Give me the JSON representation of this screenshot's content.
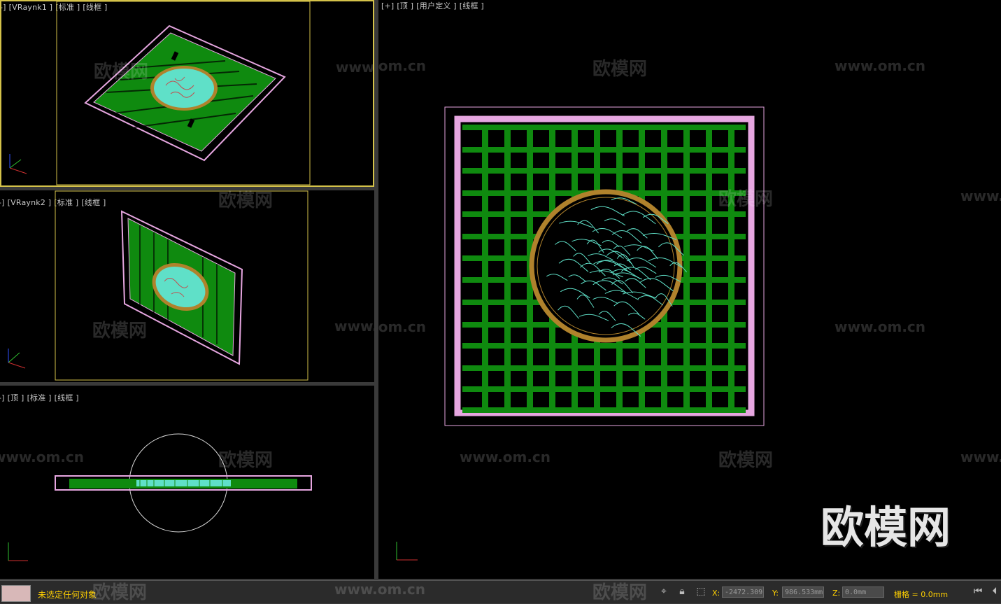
{
  "viewports": {
    "vp1": {
      "tags": [
        "-]",
        "[VRaynk1 ]",
        "[标准 ]",
        "[线框 ]"
      ]
    },
    "vp2": {
      "tags": [
        "-]",
        "[VRaynk2 ]",
        "[标准 ]",
        "[线框 ]"
      ]
    },
    "vp3": {
      "tags": [
        "-]",
        "[顶 ]",
        "[标准 ]",
        "[线框 ]"
      ]
    },
    "vp4": {
      "tags": [
        "[+]",
        "[顶 ]",
        "[用户定义 ]",
        "[线框 ]"
      ]
    }
  },
  "axis": {
    "x": "x",
    "y": "y",
    "z": "z"
  },
  "watermarks": {
    "cn": "欧模网",
    "url": "www.om.cn",
    "big": "欧模网"
  },
  "status": {
    "selection": "未选定任何对象",
    "x_label": "X:",
    "x_value": "-2472.309",
    "y_label": "Y:",
    "y_value": "986.533mm",
    "z_label": "Z:",
    "z_value": "0.0mm",
    "grid": "栅格 = 0.0mm"
  },
  "colors": {
    "lattice_green": "#0f8a0f",
    "frame_pink": "#e6a6e0",
    "ring_gold": "#b0822c",
    "medallion_cyan": "#5fe0c8",
    "active_border": "#d4c24a",
    "status_text": "#ffd000"
  },
  "icons": [
    "lock-icon",
    "snap-icon",
    "selection-icon",
    "goto-start-icon",
    "prev-frame-icon"
  ]
}
